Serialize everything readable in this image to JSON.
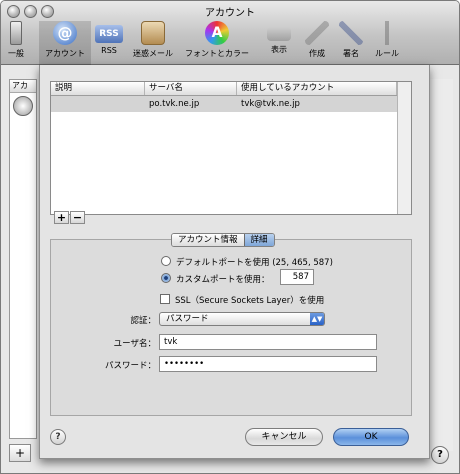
{
  "window": {
    "title": "アカウント"
  },
  "toolbar": {
    "items": [
      {
        "label": "一般",
        "icon": "switch-icon",
        "color": "#9a9a9a"
      },
      {
        "label": "アカウント",
        "icon": "at-sign-icon",
        "color": "#3b6fc4"
      },
      {
        "label": "RSS",
        "icon": "rss-icon",
        "color": "#6d8fc9"
      },
      {
        "label": "迷惑メール",
        "icon": "junk-mail-icon",
        "color": "#c8a36a"
      },
      {
        "label": "フォントとカラー",
        "icon": "color-font-icon",
        "color": "#b56ad1"
      },
      {
        "label": "表示",
        "icon": "view-icon",
        "color": "#8a8a8a"
      },
      {
        "label": "作成",
        "icon": "compose-icon",
        "color": "#8a8a8a"
      },
      {
        "label": "署名",
        "icon": "signature-icon",
        "color": "#8a8a8a"
      },
      {
        "label": "ルール",
        "icon": "rules-icon",
        "color": "#8a8a8a"
      }
    ]
  },
  "sidebar": {
    "header": "アカ"
  },
  "server_table": {
    "columns": [
      "説明",
      "サーバ名",
      "使用しているアカウント"
    ],
    "rows": [
      {
        "description": "",
        "server": "po.tvk.ne.jp",
        "account": "tvk@tvk.ne.jp"
      }
    ]
  },
  "tabs": [
    "アカウント情報",
    "詳細"
  ],
  "port_options": {
    "default_label": "デフォルトポートを使用 (25, 465, 587)",
    "custom_label": "カスタムポートを使用：",
    "custom_selected": true,
    "port_value": "587"
  },
  "ssl": {
    "label": "SSL（Secure Sockets Layer）を使用",
    "checked": false
  },
  "auth": {
    "label": "認証：",
    "value": "パスワード"
  },
  "username": {
    "label": "ユーザ名：",
    "value": "tvk"
  },
  "password": {
    "label": "パスワード：",
    "value": "••••••••"
  },
  "buttons": {
    "add": "+",
    "remove": "−",
    "cancel": "キャンセル",
    "ok": "OK",
    "help": "?"
  },
  "colors": {
    "selection": "#d4d4d4",
    "default_button": "#5b90da",
    "popup_arrow": "#2a63c8"
  }
}
